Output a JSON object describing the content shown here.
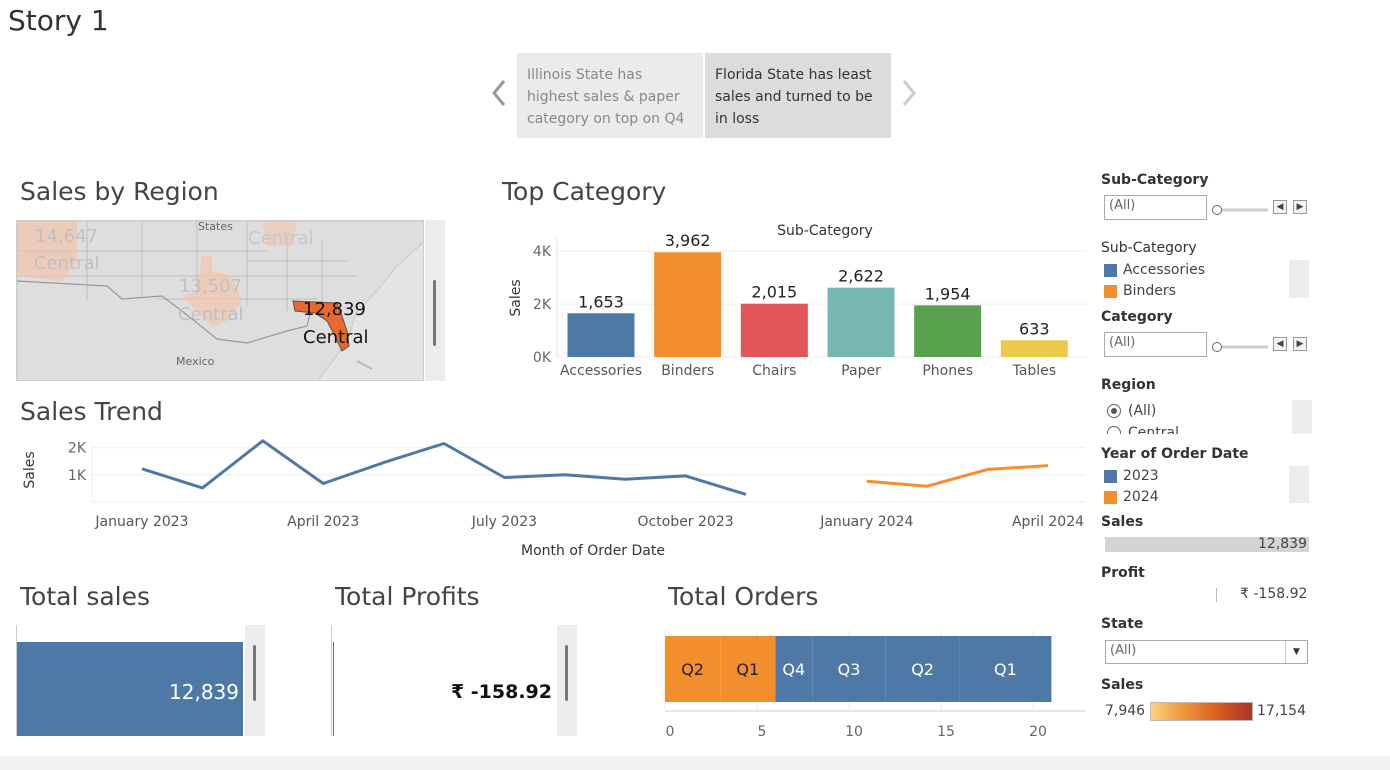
{
  "story": {
    "title": "Story 1",
    "prev_icon": "chevron-left-icon",
    "next_icon": "chevron-right-icon",
    "points": [
      {
        "text": "Illinois State has highest sales & paper category on top on Q4"
      },
      {
        "text": "Florida State has least sales and turned to be in loss"
      }
    ]
  },
  "sales_by_region": {
    "title": "Sales by Region",
    "labels": {
      "states": "States",
      "mexico": "Mexico",
      "v1": "14,647",
      "r1": "Central",
      "r2": "Central",
      "v3": "13,507",
      "r3": "Central",
      "v4": "12,839",
      "r4": "Central"
    }
  },
  "top_category": {
    "title": "Top Category"
  },
  "sales_trend": {
    "title": "Sales Trend"
  },
  "totals": {
    "sales_title": "Total sales",
    "sales_value": "12,839",
    "profits_title": "Total Profits",
    "profits_value": "₹ -158.92",
    "orders_title": "Total Orders"
  },
  "side_panel": {
    "sub_category_filter_label": "Sub-Category",
    "sub_category_filter_value": "(All)",
    "sub_category_legend_label": "Sub-Category",
    "sub_category_legend": [
      {
        "name": "Accessories",
        "color": "#4e79a7"
      },
      {
        "name": "Binders",
        "color": "#f28e2b"
      }
    ],
    "category_filter_label": "Category",
    "category_filter_value": "(All)",
    "region_label": "Region",
    "region_options": [
      "(All)",
      "Central"
    ],
    "year_label": "Year of Order Date",
    "year_legend": [
      {
        "name": "2023",
        "color": "#4e79a7"
      },
      {
        "name": "2024",
        "color": "#f28e2b"
      }
    ],
    "sales_label": "Sales",
    "sales_value": "12,839",
    "profit_label": "Profit",
    "profit_value": "₹ -158.92",
    "state_label": "State",
    "state_value": "(All)",
    "sales_range_label": "Sales",
    "sales_range_min": "7,946",
    "sales_range_max": "17,154"
  },
  "colors": {
    "blue": "#4e79a7",
    "orange": "#f28e2b",
    "red": "#e15759",
    "teal": "#76b7b2",
    "green": "#59a14f",
    "yellow": "#edc948",
    "florida": "#e8692b"
  },
  "chart_data": [
    {
      "type": "bar",
      "title": "Sub-Category",
      "ylabel": "Sales",
      "categories": [
        "Accessories",
        "Binders",
        "Chairs",
        "Paper",
        "Phones",
        "Tables"
      ],
      "values": [
        1653,
        3962,
        2015,
        2622,
        1954,
        633
      ],
      "value_labels": [
        "1,653",
        "3,962",
        "2,015",
        "2,622",
        "1,954",
        "633"
      ],
      "yticks": [
        "0K",
        "2K",
        "4K"
      ],
      "ylim": [
        0,
        4500
      ]
    },
    {
      "type": "line",
      "xlabel": "Month of Order Date",
      "ylabel": "Sales",
      "yticks": [
        "1K",
        "2K"
      ],
      "xtick_labels": [
        "January 2023",
        "April 2023",
        "July 2023",
        "October 2023",
        "January 2024",
        "April 2024"
      ],
      "series": [
        {
          "name": "2023",
          "x": [
            "2023-01",
            "2023-02",
            "2023-03",
            "2023-04",
            "2023-05",
            "2023-06",
            "2023-07",
            "2023-08",
            "2023-09",
            "2023-10",
            "2023-11"
          ],
          "values": [
            1220,
            520,
            2250,
            680,
            1450,
            2150,
            900,
            1000,
            840,
            960,
            280
          ]
        },
        {
          "name": "2024",
          "x": [
            "2024-01",
            "2024-02",
            "2024-03",
            "2024-04"
          ],
          "values": [
            760,
            580,
            1200,
            1340
          ]
        }
      ]
    },
    {
      "type": "bar",
      "title": "Total Orders",
      "orientation": "horizontal-stacked",
      "segments": [
        {
          "year": "2024",
          "label": "Q2",
          "value": 3
        },
        {
          "year": "2024",
          "label": "Q1",
          "value": 3
        },
        {
          "year": "2023",
          "label": "Q4",
          "value": 2
        },
        {
          "year": "2023",
          "label": "Q3",
          "value": 4
        },
        {
          "year": "2023",
          "label": "Q2",
          "value": 4
        },
        {
          "year": "2023",
          "label": "Q1",
          "value": 5
        }
      ],
      "xticks": [
        "0",
        "5",
        "10",
        "15",
        "20"
      ],
      "xlim": [
        0,
        23
      ]
    }
  ]
}
